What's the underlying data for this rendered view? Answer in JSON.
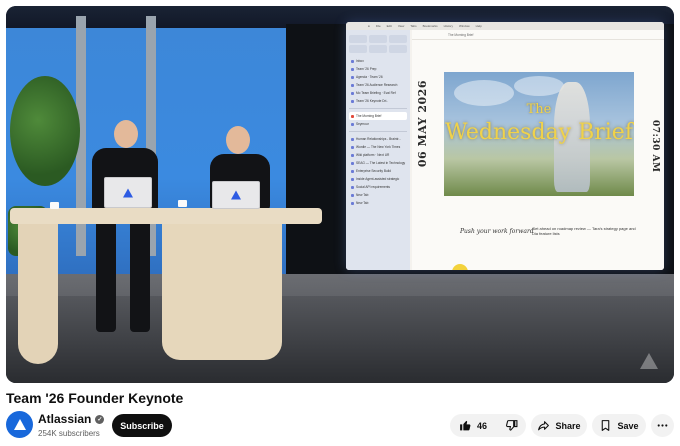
{
  "video": {
    "screen": {
      "date": "06 MAY 2026",
      "time": "07:30 AM",
      "hero_title_line1": "The",
      "hero_title_line2": "Wednesday Brief",
      "push_text": "Push your work forward",
      "sidebar_tabs": [
        "Inbox",
        "Team '26 Prep",
        "Agenda · Team '26",
        "Team '26 Audience Research",
        "Mo Team Briefing · Eval Ref",
        "Team '26 Keynote Dri..",
        "The Morning Brief",
        "Seymour",
        "Human Relationships - Braintr...",
        "Wordle — The New York Times",
        "Wiki platform · Next UR",
        "SEAG — The Latest in Technology",
        "Enterprise Security Build",
        "Inside Agent-assisted strategic",
        "Social API requirements",
        "New Tab",
        "New Tab"
      ],
      "col2_heading": "Get ahead on roadmap review — Tara's strategy page and Dia feature lists"
    }
  },
  "video_title": "Team '26 Founder Keynote",
  "channel": {
    "name": "Atlassian",
    "subscribers": "254K subscribers",
    "subscribe_label": "Subscribe"
  },
  "actions": {
    "like_count": "46",
    "share_label": "Share",
    "save_label": "Save"
  },
  "colors": {
    "brand": "#1868db",
    "subscribe_bg": "#0f0f0f",
    "pill_bg": "#f2f2f2"
  },
  "icons": [
    "verified-icon",
    "like-icon",
    "dislike-icon",
    "share-icon",
    "save-icon",
    "more-icon",
    "atlassian-logo-icon"
  ]
}
